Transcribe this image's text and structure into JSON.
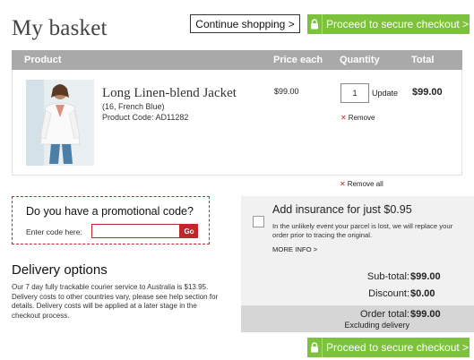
{
  "header": {
    "title": "My basket",
    "continue_label": "Continue shopping >",
    "checkout_label": "Proceed to secure checkout >"
  },
  "table": {
    "columns": [
      "Product",
      "Price each",
      "Quantity",
      "Total"
    ]
  },
  "product": {
    "name": "Long Linen-blend Jacket",
    "variant": "(16, French Blue)",
    "code": "Product Code: AD11282",
    "price_each": "$99.00",
    "quantity": "1",
    "update_label": "Update",
    "total": "$99.00",
    "remove_label": "Remove"
  },
  "remove_all_label": "Remove all",
  "promo": {
    "title": "Do you have a promotional code?",
    "label": "Enter code here:",
    "input_value": "",
    "go_label": "Go"
  },
  "delivery": {
    "title": "Delivery options",
    "text": "Our 7 day fully trackable courier service to Australia is $13.95. Delivery costs to other countries vary, please see help section for details. Delivery costs will be applied at a later stage in the checkout process."
  },
  "insurance": {
    "title": "Add insurance for just $0.95",
    "description": "In the unlikely event your parcel is lost, we will replace your order prior to tracing the original.",
    "more_info": "MORE INFO >"
  },
  "summary": {
    "subtotal_label": "Sub-total:",
    "subtotal_value": "$99.00",
    "discount_label": "Discount:",
    "discount_value": "$0.00",
    "order_total_label": "Order total:",
    "order_total_value": "$99.00",
    "excluding_label": "Excluding delivery"
  },
  "colors": {
    "accent_green": "#7dc23c",
    "accent_red": "#c0272d",
    "header_gray": "#a9a9a9"
  },
  "icons": [
    "lock-icon",
    "remove-x-icon",
    "checkbox"
  ]
}
